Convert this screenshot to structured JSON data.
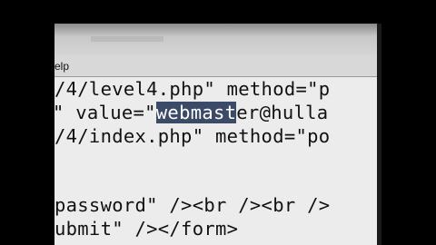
{
  "window": {
    "menu_help_fragment": "elp"
  },
  "editor": {
    "lines": [
      "/4/level4.php\" method=\"p",
      "\" value=\"",
      "/4/index.php\" method=\"po",
      "",
      "password\" /><br /><br />",
      "ubmit\" /></form>"
    ],
    "line2_selected": "webmast",
    "line2_after": "er@hulla"
  }
}
